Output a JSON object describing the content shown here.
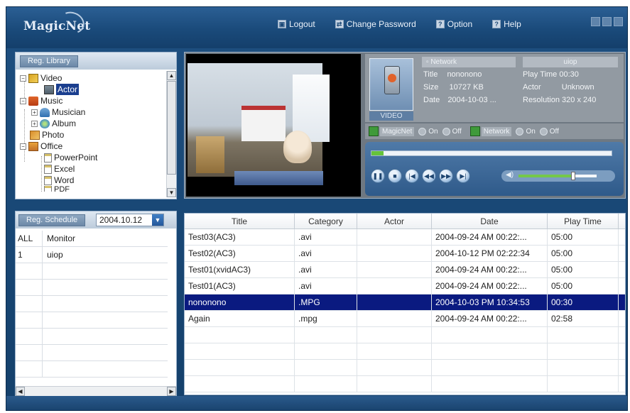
{
  "app": {
    "logo": "MagicNet"
  },
  "header": {
    "menu": [
      {
        "label": "Logout",
        "glyph": "▣"
      },
      {
        "label": "Change Password",
        "glyph": "⇄"
      },
      {
        "label": "Option",
        "glyph": "?"
      },
      {
        "label": "Help",
        "glyph": "?"
      }
    ]
  },
  "library": {
    "tab": "Reg. Library",
    "tree": {
      "video": "Video",
      "actor": "Actor",
      "music": "Music",
      "musician": "Musician",
      "album": "Album",
      "photo": "Photo",
      "office": "Office",
      "powerpoint": "PowerPoint",
      "excel": "Excel",
      "word": "Word",
      "pdf": "PDF"
    }
  },
  "preview": {
    "thumb_label": "VIDEO",
    "network_header": "Network",
    "name_header": "uiop",
    "title_key": "Title",
    "title_val": "nononono",
    "size_key": "Size",
    "size_val": "10727 KB",
    "date_key": "Date",
    "date_val": "2004-10-03 ...",
    "playtime": "Play Time 00:30",
    "actor_key": "Actor",
    "actor_val": "Unknown",
    "resolution": "Resolution 320 x 240",
    "toggles": {
      "magicnet": "MagicNet",
      "network": "Network",
      "on": "On",
      "off": "Off"
    },
    "seek_progress": 0.05,
    "volume_level": 0.7
  },
  "schedule": {
    "tab": "Reg. Schedule",
    "date": "2004.10.12",
    "rows": [
      {
        "id": "ALL",
        "name": "Monitor"
      },
      {
        "id": "1",
        "name": "uiop"
      }
    ]
  },
  "files": {
    "headers": [
      "Title",
      "Category",
      "Actor",
      "Date",
      "Play Time"
    ],
    "rows": [
      {
        "title": "Test03(AC3)",
        "category": ".avi",
        "actor": "",
        "date": "2004-09-24 AM 00:22:...",
        "time": "05:00"
      },
      {
        "title": "Test02(AC3)",
        "category": ".avi",
        "actor": "",
        "date": "2004-10-12 PM 02:22:34",
        "time": "05:00"
      },
      {
        "title": "Test01(xvidAC3)",
        "category": ".avi",
        "actor": "",
        "date": "2004-09-24 AM 00:22:...",
        "time": "05:00"
      },
      {
        "title": "Test01(AC3)",
        "category": ".avi",
        "actor": "",
        "date": "2004-09-24 AM 00:22:...",
        "time": "05:00"
      },
      {
        "title": "nononono",
        "category": ".MPG",
        "actor": "",
        "date": "2004-10-03 PM 10:34:53",
        "time": "00:30"
      },
      {
        "title": "Again",
        "category": ".mpg",
        "actor": "",
        "date": "2004-09-24 AM 00:22:...",
        "time": "02:58"
      }
    ],
    "selected_index": 4
  }
}
